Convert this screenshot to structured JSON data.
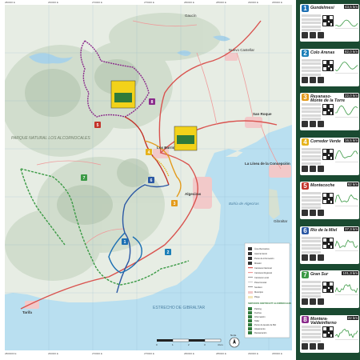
{
  "map": {
    "places": {
      "gaucin": "Gaucín",
      "nuevo_castellar": "Nuevo Castellar",
      "parque": "PARQUE NATURAL LOS ALCORNOCALES",
      "los_barrios": "Los Barrios",
      "san_roque": "San Roque",
      "la_linea": "La Línea de la Concepción",
      "algeciras": "Algeciras",
      "bahia": "Bahía de Algeciras",
      "gibraltar": "Gibraltar",
      "tarifa": "Tarifa",
      "estrecho": "ESTRECHO DE GIBRALTAR"
    },
    "route_markers": [
      "1",
      "2",
      "3",
      "4",
      "5",
      "6",
      "7",
      "8"
    ],
    "legend": {
      "items": [
        "Área Recreativa",
        "Aparcamiento",
        "Punto de información",
        "Mirador",
        "Carretera Nacional",
        "Carretera Regional",
        "Carretera Local",
        "Pista forestal",
        "Sendero",
        "Municipio",
        "Playa"
      ],
      "services_title": "SERVICIOS CENTRO BTT ALCORNOCALES",
      "services": [
        "Parking",
        "Duchas",
        "Información",
        "Taller",
        "Punto de lavado de Bici",
        "Alojamiento",
        "Restauración"
      ]
    },
    "scale": {
      "labels": [
        "0",
        "1",
        "2",
        "3",
        "4 km"
      ]
    },
    "north": "Norte",
    "grid_coords_top": [
      "280000 E",
      "260000 E",
      "270000 E",
      "275000 E",
      "280000 E",
      "285000 E",
      "290000 E",
      "295000 E"
    ],
    "grid_coords_bottom": [
      "2800000 E",
      "260000 E",
      "270000 E",
      "275000 E",
      "280000 E",
      "285000 E",
      "290000 E",
      "295000 E"
    ]
  },
  "routes": [
    {
      "num": "1",
      "name": "Gundelmesí",
      "name2": "",
      "dist": "43,5 km",
      "color": "#1b6fb3"
    },
    {
      "num": "2",
      "name": "Colo Arenas",
      "name2": "",
      "dist": "82,0 km",
      "color": "#1b7fb8"
    },
    {
      "num": "3",
      "name": "Reyanaso-",
      "name2": "Monte de la Torre",
      "dist": "22,0 km",
      "color": "#e39b1c"
    },
    {
      "num": "4",
      "name": "Corredor Verde",
      "name2": "",
      "dist": "16,5 km",
      "color": "#e6b21b"
    },
    {
      "num": "5",
      "name": "Montecoche",
      "name2": "",
      "dist": "62 km",
      "color": "#c3342b"
    },
    {
      "num": "6",
      "name": "Río de la Miel",
      "name2": "",
      "dist": "37,3 km",
      "color": "#2b58a4"
    },
    {
      "num": "7",
      "name": "Gran Sur",
      "name2": "",
      "dist": "101,3 km",
      "color": "#3b9a45"
    },
    {
      "num": "8",
      "name": "Montera-",
      "name2": "Valdeinfierno",
      "dist": "22 km",
      "color": "#8a2b8b"
    }
  ],
  "colors": {
    "sea": "#b9dff0",
    "land": "#e7ede4",
    "relief": "#c9d6c5",
    "panel": "#1a4a31",
    "roads_main": "#d9534f",
    "roads_local": "#ef9a9a"
  }
}
